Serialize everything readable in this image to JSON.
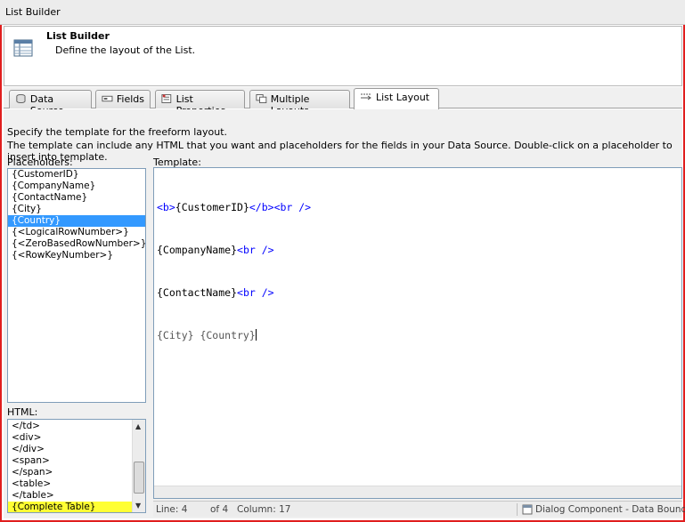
{
  "window": {
    "title": "List Builder"
  },
  "header": {
    "title": "List Builder",
    "subtitle": "Define the layout of the List."
  },
  "tabs": [
    {
      "label": "Data Source",
      "icon": "database-icon"
    },
    {
      "label": "Fields",
      "icon": "fields-icon"
    },
    {
      "label": "List Properties",
      "icon": "properties-icon"
    },
    {
      "label": "Multiple Layouts",
      "icon": "multiple-layouts-icon"
    },
    {
      "label": "List Layout",
      "icon": "list-layout-icon",
      "active": true
    }
  ],
  "description": {
    "line1": "Specify the template for the freeform layout.",
    "line2": "The template can include any HTML that you want and placeholders for the fields in your Data Source. Double-click on a placeholder to insert into template."
  },
  "placeholders": {
    "label": "Placeholders:",
    "items": [
      "{CustomerID}",
      "{CompanyName}",
      "{ContactName}",
      "{City}",
      "{Country}",
      "{<LogicalRowNumber>}",
      "{<ZeroBasedRowNumber>}",
      "{<RowKeyNumber>}"
    ],
    "selected": "{Country}"
  },
  "html_list": {
    "label": "HTML:",
    "items": [
      "</td>",
      "<div>",
      "</div>",
      "<span>",
      "</span>",
      "<table>",
      "</table>",
      "{Complete Table}"
    ],
    "highlighted": "{Complete Table}"
  },
  "template": {
    "label": "Template:",
    "lines": [
      {
        "parts": [
          {
            "t": "<b>",
            "c": "tag"
          },
          {
            "t": "{CustomerID}",
            "c": "txt"
          },
          {
            "t": "</b><br />",
            "c": "tag"
          }
        ]
      },
      {
        "parts": [
          {
            "t": "{CompanyName}",
            "c": "txt"
          },
          {
            "t": "<br />",
            "c": "tag"
          }
        ]
      },
      {
        "parts": [
          {
            "t": "{ContactName}",
            "c": "txt"
          },
          {
            "t": "<br />",
            "c": "tag"
          }
        ]
      },
      {
        "parts": [
          {
            "t": "{City} {Country}",
            "c": "gry"
          }
        ]
      }
    ]
  },
  "status": {
    "line": "Line: 4",
    "of": "of 4",
    "column": "Column: 17",
    "component": "Dialog Component - Data Bound Di"
  },
  "colors": {
    "selection": "#3399ff",
    "highlight": "#ffff33",
    "tag": "#0000ff",
    "frame": "#e01e1e"
  }
}
